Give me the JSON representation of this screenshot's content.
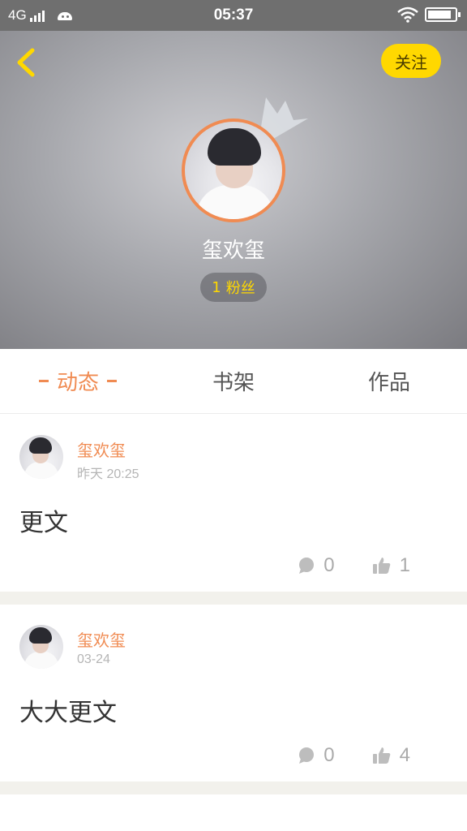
{
  "status_bar": {
    "network": "4G",
    "time": "05:37"
  },
  "header": {
    "follow_label": "关注",
    "profile_name": "玺欢玺",
    "fans_count": "1",
    "fans_label": "粉丝"
  },
  "tabs": [
    {
      "label": "动态",
      "active": true
    },
    {
      "label": "书架",
      "active": false
    },
    {
      "label": "作品",
      "active": false
    }
  ],
  "posts": [
    {
      "author": "玺欢玺",
      "time": "昨天 20:25",
      "content": "更文",
      "comments": "0",
      "likes": "1"
    },
    {
      "author": "玺欢玺",
      "time": "03-24",
      "content": "大大更文",
      "comments": "0",
      "likes": "4"
    }
  ],
  "colors": {
    "accent": "#f08b52",
    "follow_bg": "#ffd800",
    "fans_text": "#ffd800",
    "divider": "#f2f1ec"
  }
}
